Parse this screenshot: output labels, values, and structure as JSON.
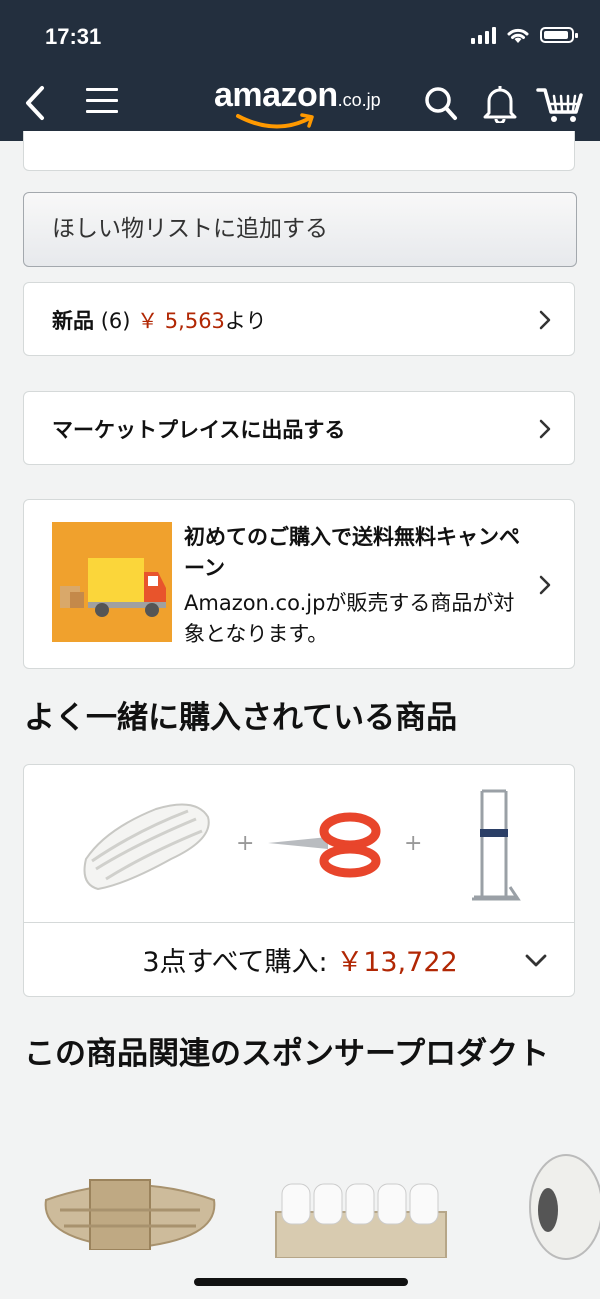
{
  "status": {
    "time": "17:31"
  },
  "header": {
    "logo_text": "amazon",
    "logo_tld": ".co.jp",
    "brand_color": "#232f3e",
    "accent_color": "#ff9900"
  },
  "icons": {
    "back": "chevron-left-icon",
    "menu": "hamburger-icon",
    "search": "search-icon",
    "notifications": "bell-icon",
    "cart": "cart-icon"
  },
  "actions": {
    "wishlist_label": "ほしい物リストに追加する"
  },
  "offers": {
    "new_label": "新品",
    "new_count": "(6)",
    "new_price": "￥ 5,563",
    "new_suffix": "より",
    "marketplace_label": "マーケットプレイスに出品する"
  },
  "promo": {
    "title": "初めてのご購入で送料無料キャンペーン",
    "body": "Amazon.co.jpが販売する商品が対象となります。"
  },
  "frequently_bought": {
    "heading": "よく一緒に購入されている商品",
    "items": [
      "rope-product",
      "scissors-product",
      "stand-product"
    ],
    "total_label": "3点すべて購入: ",
    "total_price": "￥13,722"
  },
  "sponsored": {
    "heading": "この商品関連のスポンサープロダクト",
    "items": [
      "jute-rope-product",
      "receipt-paper-rolls-product",
      "white-rope-spool-product"
    ]
  },
  "colors": {
    "price": "#b12704"
  }
}
